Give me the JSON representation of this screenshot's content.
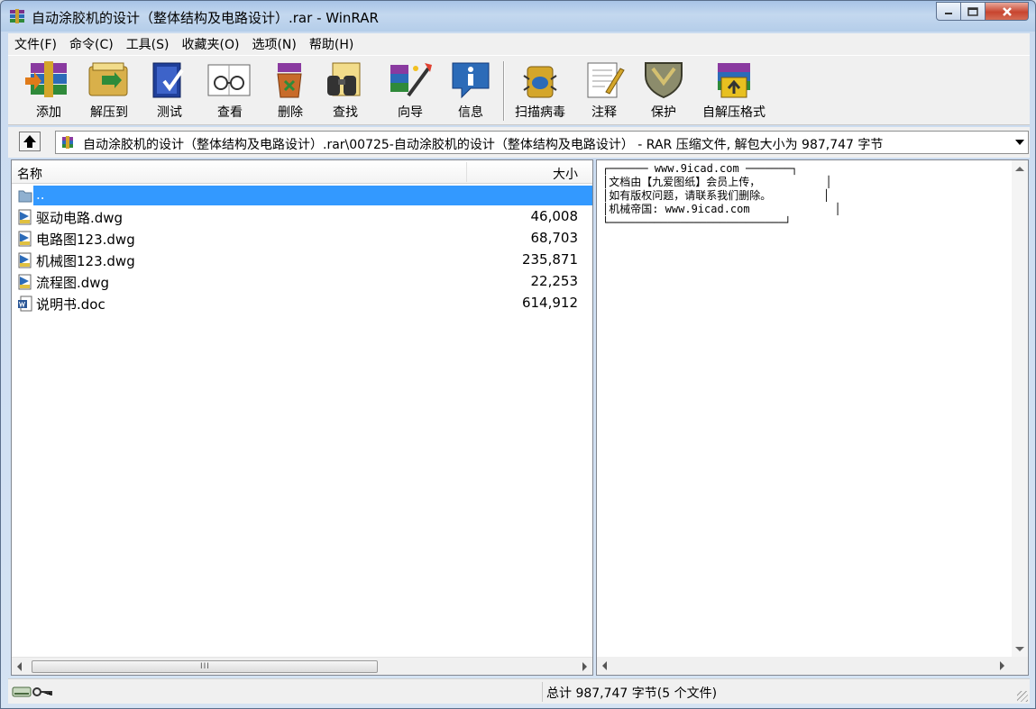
{
  "window": {
    "title": "自动涂胶机的设计（整体结构及电路设计）.rar - WinRAR"
  },
  "menu": [
    "文件(F)",
    "命令(C)",
    "工具(S)",
    "收藏夹(O)",
    "选项(N)",
    "帮助(H)"
  ],
  "toolbar": [
    {
      "label": "添加",
      "icon": "add-archive-icon"
    },
    {
      "label": "解压到",
      "icon": "extract-to-icon"
    },
    {
      "label": "测试",
      "icon": "test-icon"
    },
    {
      "label": "查看",
      "icon": "view-icon"
    },
    {
      "label": "删除",
      "icon": "delete-icon"
    },
    {
      "label": "查找",
      "icon": "find-icon"
    },
    {
      "label": "向导",
      "icon": "wizard-icon"
    },
    {
      "label": "信息",
      "icon": "info-icon"
    },
    {
      "label": "扫描病毒",
      "icon": "virus-scan-icon"
    },
    {
      "label": "注释",
      "icon": "comment-icon"
    },
    {
      "label": "保护",
      "icon": "protect-icon"
    },
    {
      "label": "自解压格式",
      "icon": "sfx-icon"
    }
  ],
  "address": {
    "path": "自动涂胶机的设计（整体结构及电路设计）.rar\\00725-自动涂胶机的设计（整体结构及电路设计） - RAR 压缩文件, 解包大小为 987,747 字节"
  },
  "file_list": {
    "col_name": "名称",
    "col_size": "大小",
    "parent": "..",
    "rows": [
      {
        "name": "驱动电路.dwg",
        "size": "46,008",
        "type": "dwg"
      },
      {
        "name": "电路图123.dwg",
        "size": "68,703",
        "type": "dwg"
      },
      {
        "name": "机械图123.dwg",
        "size": "235,871",
        "type": "dwg"
      },
      {
        "name": "流程图.dwg",
        "size": "22,253",
        "type": "dwg"
      },
      {
        "name": "说明书.doc",
        "size": "614,912",
        "type": "doc"
      }
    ]
  },
  "comment": {
    "text": "┌────── www.9icad.com ───────┐\n│文档由【九爱图纸】会员上传，          │\n│如有版权问题，请联系我们删除。        │\n│机械帝国: www.9icad.com             │\n└───────────────────────────┘"
  },
  "status": {
    "summary": "总计 987,747 字节(5 个文件)"
  },
  "colors": {
    "selection": "#3399ff",
    "menu_bg": "#f0f0f0",
    "close_button": "#c8452f"
  }
}
